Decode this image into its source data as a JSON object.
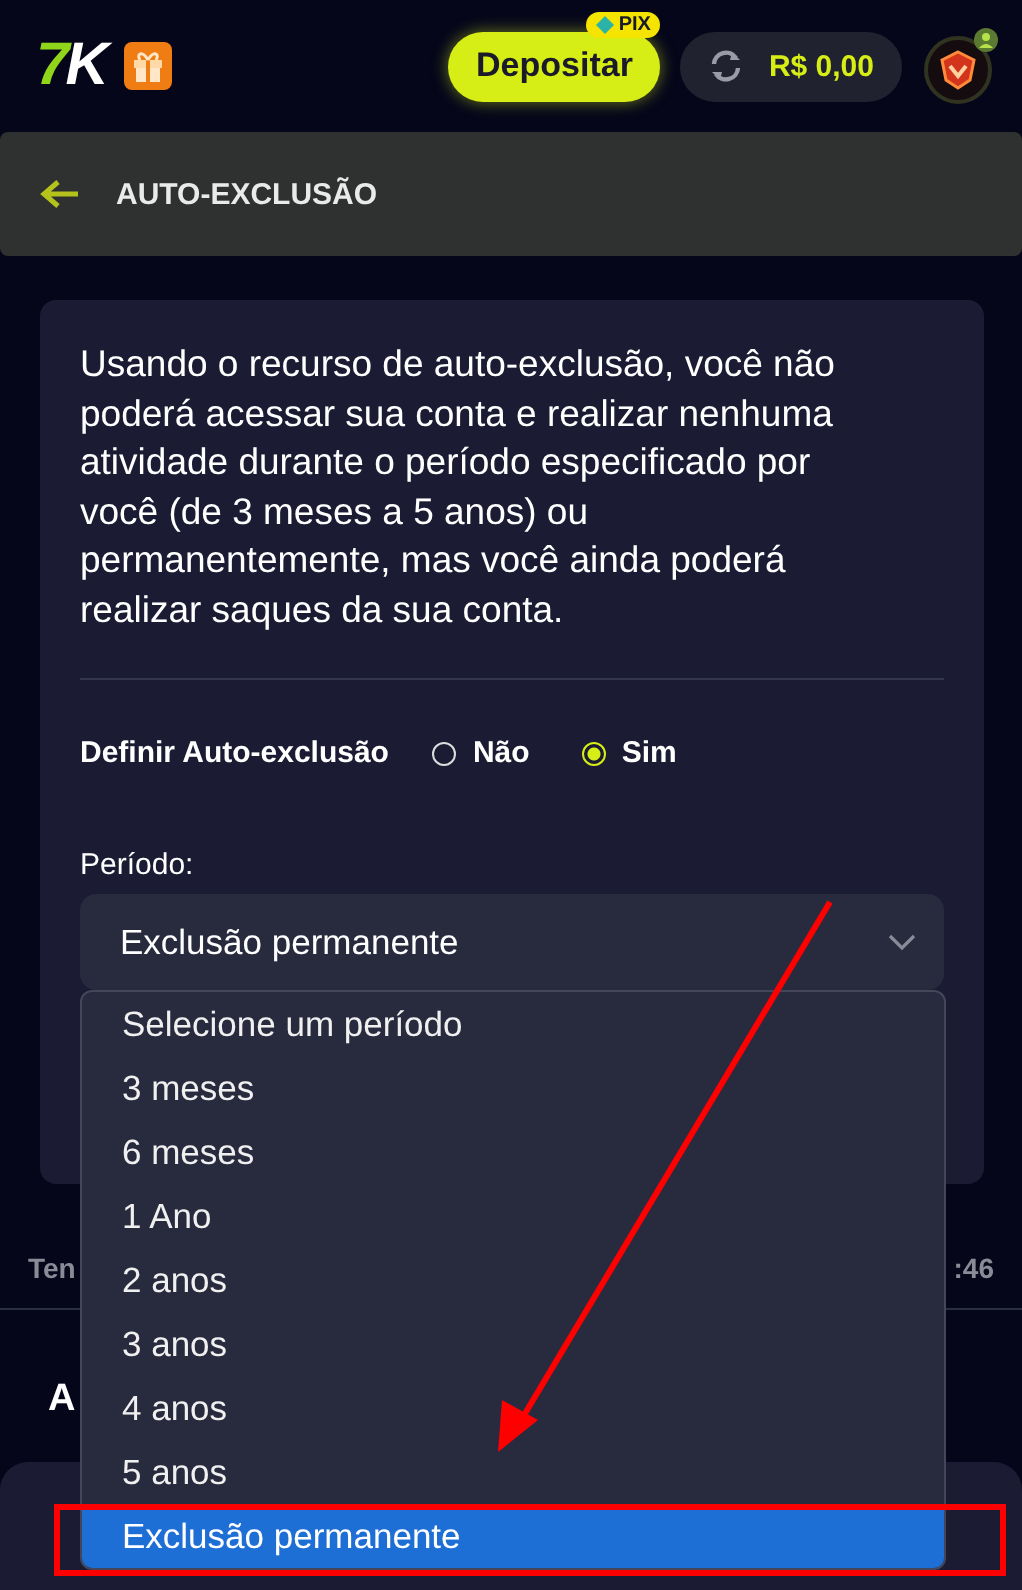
{
  "header": {
    "logo": {
      "first": "7",
      "second": "K"
    },
    "deposit_button": "Depositar",
    "pix_badge": "PIX",
    "balance": "R$ 0,00"
  },
  "title_bar": {
    "title": "AUTO-EXCLUSÃO"
  },
  "card": {
    "description": "Usando o recurso de auto-exclusão, você não poderá acessar sua conta e realizar nenhuma atividade durante o período especificado por você (de 3 meses a 5 anos) ou permanentemente, mas você ainda poderá realizar saques da sua conta.",
    "setting_label": "Definir Auto-exclusão",
    "radios": [
      {
        "label": "Não",
        "selected": false
      },
      {
        "label": "Sim",
        "selected": true
      }
    ],
    "period_label": "Período:",
    "select": {
      "value": "Exclusão permanente",
      "expanded": true
    }
  },
  "dropdown": [
    {
      "label": "Selecione um período",
      "selected": false
    },
    {
      "label": "3 meses",
      "selected": false
    },
    {
      "label": "6 meses",
      "selected": false
    },
    {
      "label": "1 Ano",
      "selected": false
    },
    {
      "label": "2 anos",
      "selected": false
    },
    {
      "label": "3 anos",
      "selected": false
    },
    {
      "label": "4 anos",
      "selected": false
    },
    {
      "label": "5 anos",
      "selected": false
    },
    {
      "label": "Exclusão permanente",
      "selected": true
    }
  ],
  "background": {
    "row_label": "Ten",
    "row_value": ":46",
    "heading": "A"
  },
  "annotations": {
    "arrow": true,
    "highlight_box": true
  }
}
